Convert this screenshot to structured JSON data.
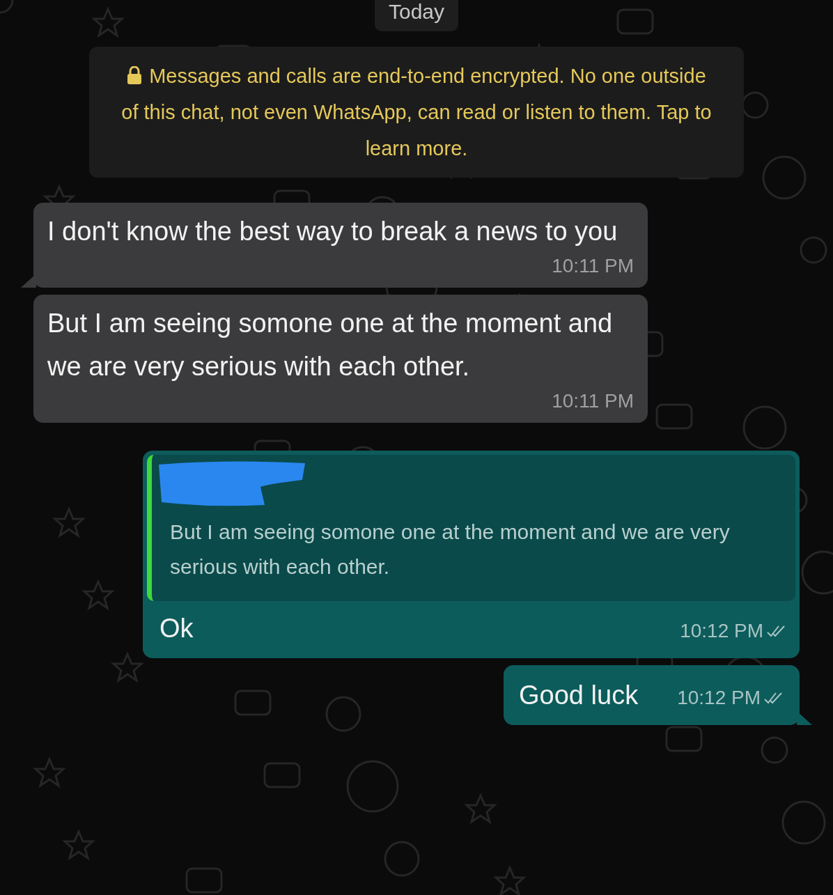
{
  "date_chip": "Today",
  "encryption_notice": {
    "text": "Messages and calls are end-to-end encrypted. No one outside of this chat, not even WhatsApp, can read or listen to them. Tap to learn more."
  },
  "messages": [
    {
      "kind": "incoming",
      "text": "I don't know the best way to break a news to you",
      "time": "10:11 PM",
      "tail": true
    },
    {
      "kind": "incoming",
      "text": "But I am seeing somone one at the moment and we are very serious with each other.",
      "time": "10:11 PM",
      "tail": false
    },
    {
      "kind": "outgoing",
      "text": "Ok",
      "time": "10:12 PM",
      "tail": false,
      "reply": {
        "sender_redacted": true,
        "text": "But I am seeing somone one at the moment and we are very serious with each other."
      }
    },
    {
      "kind": "outgoing",
      "text": "Good luck",
      "time": "10:12 PM",
      "tail": true
    }
  ]
}
